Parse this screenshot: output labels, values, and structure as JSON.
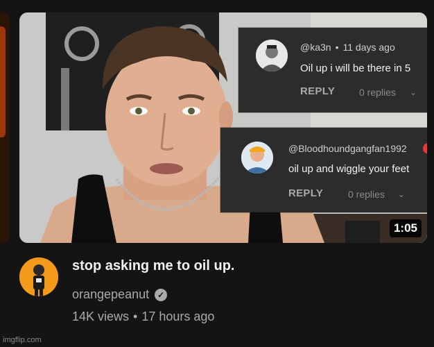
{
  "video": {
    "duration": "1:05",
    "title": "stop asking me to oil up.",
    "channel": "orangepeanut",
    "views": "14K views",
    "separator": "•",
    "age": "17 hours ago"
  },
  "comments": [
    {
      "handle": "@ka3n",
      "dot": "•",
      "age": "11 days ago",
      "text": "Oil up i will be there in 5",
      "reply_label": "REPLY",
      "replies": "0 replies"
    },
    {
      "handle": "@Bloodhoundgangfan1992",
      "text": "oil up and wiggle your feet",
      "reply_label": "REPLY",
      "replies": "0 replies"
    }
  ],
  "watermark": "imgflip.com",
  "icons": {
    "verified": "verified-check-icon",
    "chevron": "chevron-down-icon"
  },
  "colors": {
    "background": "#141414",
    "comment_bg": "#2c2c2c",
    "channel_avatar": "#f49a1a",
    "badge_red": "#e53935"
  }
}
